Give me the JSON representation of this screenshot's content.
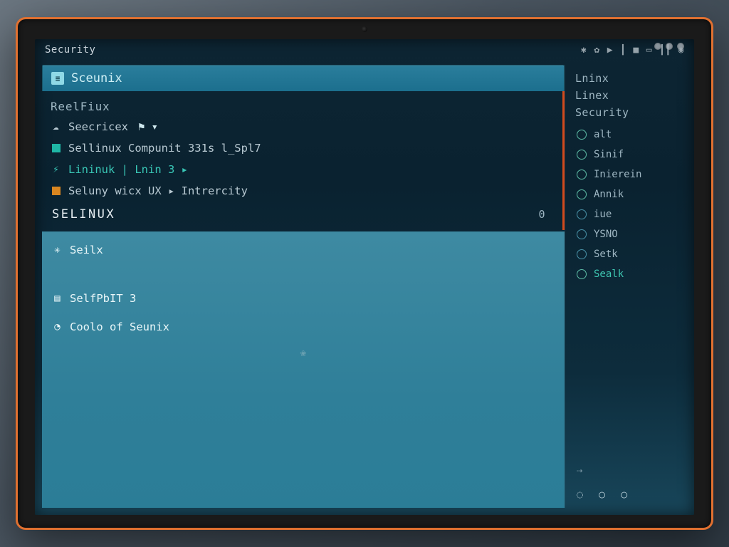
{
  "window": {
    "title": "Security",
    "tray_icons": [
      "puzzle-icon",
      "bug-icon",
      "play-icon",
      "tally-icon",
      "stop-icon",
      "battery-icon",
      "bars-icon",
      "globe-icon"
    ]
  },
  "main": {
    "tab": {
      "icon": "terminal-icon",
      "label": "Sceunix"
    },
    "header_a": "ReelFiux",
    "items_a": [
      {
        "icon": "cloud-icon",
        "label": "Seecricex",
        "trailing": "⚑ ▾"
      },
      {
        "icon": "square-teal",
        "label": "Sellinux Compunit 331s l_Spl7"
      },
      {
        "icon": "bolt-teal",
        "label": "Lininuk | Lnin 3 ▸",
        "teal": true
      },
      {
        "icon": "square-orange",
        "label": "Seluny wicx UX ▸ Intrercity"
      }
    ],
    "section_header": "SELINUX",
    "section_count": "0",
    "items_b": [
      {
        "icon": "snow-icon",
        "label": "Seilx"
      },
      {
        "icon": "book-icon",
        "label": "SelfPbIT 3"
      },
      {
        "icon": "clock-icon",
        "label": "Coolo of Seunix"
      }
    ]
  },
  "sidebar": {
    "headers": [
      "Lninx",
      "Linex",
      "Security"
    ],
    "items": [
      {
        "label": "alt"
      },
      {
        "label": "Sinif"
      },
      {
        "label": "Inierein"
      },
      {
        "label": "Annik"
      },
      {
        "label": "iue"
      },
      {
        "label": "YSNO"
      },
      {
        "label": "Setk"
      },
      {
        "label": "Sealk",
        "on": true
      }
    ],
    "bottom_icons": [
      "chat-icon",
      "circle-icon",
      "circle-icon"
    ]
  }
}
